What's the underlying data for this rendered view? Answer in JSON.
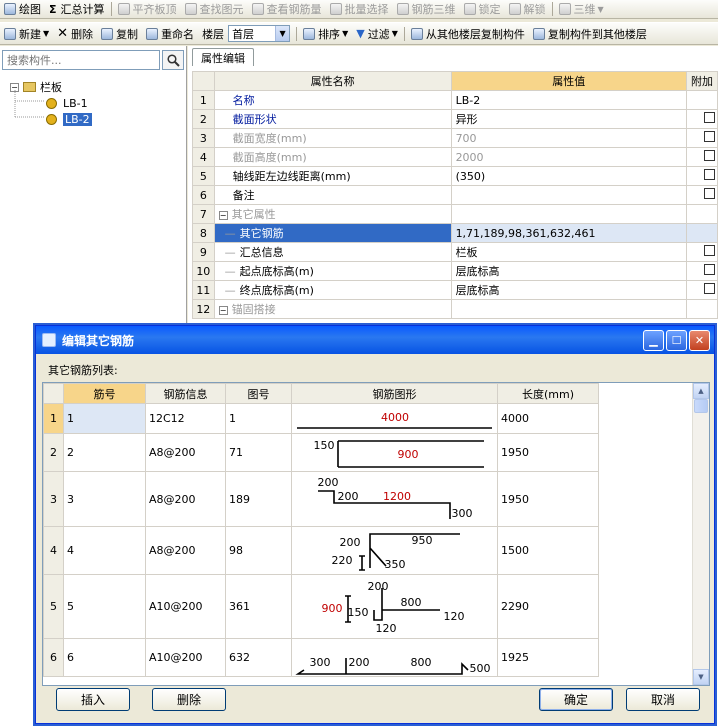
{
  "toolbar1": {
    "items": [
      {
        "label": "绘图",
        "enabled": true
      },
      {
        "label": "汇总计算",
        "enabled": true
      },
      {
        "label": "平齐板顶",
        "enabled": false
      },
      {
        "label": "查找图元",
        "enabled": false
      },
      {
        "label": "查看钢筋量",
        "enabled": false
      },
      {
        "label": "批量选择",
        "enabled": false
      },
      {
        "label": "钢筋三维",
        "enabled": false
      },
      {
        "label": "锁定",
        "enabled": false
      },
      {
        "label": "解锁",
        "enabled": false
      },
      {
        "label": "三维",
        "enabled": false
      }
    ],
    "sigma": "Σ"
  },
  "toolbar2": {
    "new_label": "新建",
    "delete_label": "删除",
    "copy_label": "复制",
    "rename_label": "重命名",
    "floor_label": "楼层",
    "floor_value": "首层",
    "sort_label": "排序",
    "filter_label": "过滤",
    "copy_from_floor_label": "从其他楼层复制构件",
    "copy_to_floor_label": "复制构件到其他楼层"
  },
  "left_panel": {
    "search_placeholder": "搜索构件...",
    "tree": {
      "root": "栏板",
      "children": [
        {
          "label": "LB-1",
          "selected": false
        },
        {
          "label": "LB-2",
          "selected": true
        }
      ]
    }
  },
  "property_panel": {
    "tab": "属性编辑",
    "columns": {
      "name": "属性名称",
      "value": "属性值",
      "extra": "附加"
    },
    "rows": [
      {
        "n": "1",
        "name": "名称",
        "value": "LB-2",
        "style": "link",
        "cb": false,
        "indent": 0
      },
      {
        "n": "2",
        "name": "截面形状",
        "value": "异形",
        "style": "link",
        "cb": true,
        "indent": 0
      },
      {
        "n": "3",
        "name": "截面宽度(mm)",
        "value": "700",
        "style": "gray",
        "cb": true,
        "indent": 0
      },
      {
        "n": "4",
        "name": "截面高度(mm)",
        "value": "2000",
        "style": "gray",
        "cb": true,
        "indent": 0
      },
      {
        "n": "5",
        "name": "轴线距左边线距离(mm)",
        "value": "(350)",
        "style": "normal",
        "cb": true,
        "indent": 0
      },
      {
        "n": "6",
        "name": "备注",
        "value": "",
        "style": "normal",
        "cb": true,
        "indent": 0
      },
      {
        "n": "7",
        "name": "其它属性",
        "value": "",
        "style": "group",
        "cb": false,
        "indent": 0
      },
      {
        "n": "8",
        "name": "其它钢筋",
        "value": "1,71,189,98,361,632,461",
        "style": "selected",
        "cb": false,
        "indent": 1
      },
      {
        "n": "9",
        "name": "汇总信息",
        "value": "栏板",
        "style": "normal",
        "cb": true,
        "indent": 1
      },
      {
        "n": "10",
        "name": "起点底标高(m)",
        "value": "层底标高",
        "style": "normal",
        "cb": true,
        "indent": 1
      },
      {
        "n": "11",
        "name": "终点底标高(m)",
        "value": "层底标高",
        "style": "normal",
        "cb": true,
        "indent": 1
      },
      {
        "n": "12",
        "name": "锚固搭接",
        "value": "",
        "style": "group",
        "cb": false,
        "indent": 0
      }
    ]
  },
  "dialog": {
    "title": "编辑其它钢筋",
    "list_label": "其它钢筋列表:",
    "columns": {
      "bar_no": "筋号",
      "info": "钢筋信息",
      "fig": "图号",
      "shape": "钢筋图形",
      "length": "长度(mm)"
    },
    "rows": [
      {
        "n": "1",
        "bar_no": "1",
        "info": "12C12",
        "fig": "1",
        "length": "4000",
        "dims": [
          "4000"
        ]
      },
      {
        "n": "2",
        "bar_no": "2",
        "info": "A8@200",
        "fig": "71",
        "length": "1950",
        "dims": [
          "150",
          "900"
        ]
      },
      {
        "n": "3",
        "bar_no": "3",
        "info": "A8@200",
        "fig": "189",
        "length": "1950",
        "dims": [
          "200",
          "200",
          "1200",
          "300"
        ]
      },
      {
        "n": "4",
        "bar_no": "4",
        "info": "A8@200",
        "fig": "98",
        "length": "1500",
        "dims": [
          "200",
          "950",
          "220",
          "350"
        ]
      },
      {
        "n": "5",
        "bar_no": "5",
        "info": "A10@200",
        "fig": "361",
        "length": "2290",
        "dims": [
          "200",
          "800",
          "900",
          "150",
          "120",
          "120"
        ]
      },
      {
        "n": "6",
        "bar_no": "6",
        "info": "A10@200",
        "fig": "632",
        "length": "1925",
        "dims": [
          "300",
          "200",
          "800",
          "500"
        ]
      }
    ],
    "buttons": {
      "insert": "插入",
      "delete": "删除",
      "ok": "确定",
      "cancel": "取消"
    },
    "accent_red": "#c00000"
  }
}
